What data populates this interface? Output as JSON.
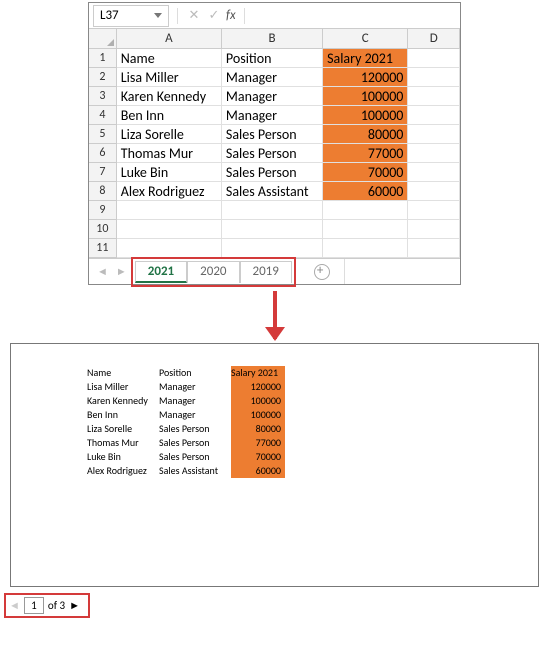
{
  "formula_bar": {
    "cell_ref": "L37",
    "fx_label": "fx",
    "value": ""
  },
  "columns": [
    "A",
    "B",
    "C",
    "D"
  ],
  "rows": [
    {
      "n": "1",
      "a": "Name",
      "b": "Position",
      "c": "Salary 2021",
      "orange": true,
      "left": true
    },
    {
      "n": "2",
      "a": "Lisa Miller",
      "b": "Manager",
      "c": "120000",
      "orange": true
    },
    {
      "n": "3",
      "a": "Karen Kennedy",
      "b": "Manager",
      "c": "100000",
      "orange": true
    },
    {
      "n": "4",
      "a": "Ben Inn",
      "b": "Manager",
      "c": "100000",
      "orange": true
    },
    {
      "n": "5",
      "a": "Liza Sorelle",
      "b": "Sales Person",
      "c": "80000",
      "orange": true
    },
    {
      "n": "6",
      "a": "Thomas Mur",
      "b": "Sales Person",
      "c": "77000",
      "orange": true
    },
    {
      "n": "7",
      "a": "Luke Bin",
      "b": "Sales Person",
      "c": "70000",
      "orange": true
    },
    {
      "n": "8",
      "a": "Alex Rodriguez",
      "b": "Sales Assistant",
      "c": "60000",
      "orange": true
    },
    {
      "n": "9",
      "a": "",
      "b": "",
      "c": ""
    },
    {
      "n": "10",
      "a": "",
      "b": "",
      "c": ""
    },
    {
      "n": "11",
      "a": "",
      "b": "",
      "c": ""
    }
  ],
  "sheet_tabs": {
    "active": "2021",
    "others": [
      "2020",
      "2019"
    ]
  },
  "preview_rows": [
    {
      "a": "Name",
      "b": "Position",
      "c": "Salary 2021",
      "left": true
    },
    {
      "a": "Lisa Miller",
      "b": "Manager",
      "c": "120000"
    },
    {
      "a": "Karen Kennedy",
      "b": "Manager",
      "c": "100000"
    },
    {
      "a": "Ben Inn",
      "b": "Manager",
      "c": "100000"
    },
    {
      "a": "Liza Sorelle",
      "b": "Sales Person",
      "c": "80000"
    },
    {
      "a": "Thomas Mur",
      "b": "Sales Person",
      "c": "77000"
    },
    {
      "a": "Luke Bin",
      "b": "Sales Person",
      "c": "70000"
    },
    {
      "a": "Alex Rodriguez",
      "b": "Sales Assistant",
      "c": "60000"
    }
  ],
  "page_nav": {
    "current": "1",
    "of_label": "of 3"
  }
}
